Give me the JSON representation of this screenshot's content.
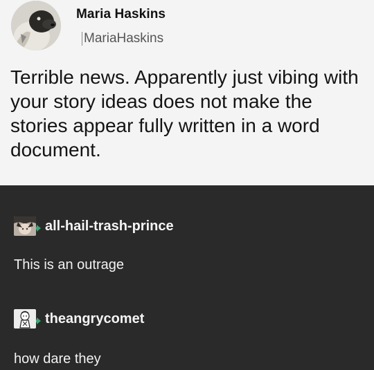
{
  "tweet": {
    "display_name": "Maria Haskins",
    "handle": "MariaHaskins",
    "body": "Terrible news. Apparently just vibing with your story ideas does not make the stories appear fully written in a word document.",
    "avatar_icon": "avatar-photo-dog"
  },
  "reblogs": [
    {
      "username": "all-hail-trash-prince",
      "text": "This is an outrage",
      "avatar_icon": "avatar-anime-character",
      "reblog_icon": "reblog-icon"
    },
    {
      "username": "theangrycomet",
      "text": "how dare they",
      "avatar_icon": "avatar-cartoon-character",
      "reblog_icon": "reblog-icon"
    }
  ],
  "colors": {
    "tweet_background": "#f4f4f4",
    "tumblr_background": "#2a2a2a",
    "reblog_icon_green": "#3aa872"
  }
}
